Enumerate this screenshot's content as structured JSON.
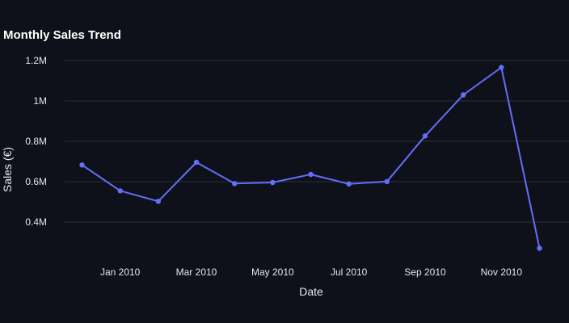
{
  "chart_data": {
    "type": "line",
    "title": "Monthly Sales Trend",
    "xlabel": "Date",
    "ylabel": "Sales (€)",
    "x": [
      "2009-12",
      "2010-01",
      "2010-02",
      "2010-03",
      "2010-04",
      "2010-05",
      "2010-06",
      "2010-07",
      "2010-08",
      "2010-09",
      "2010-10",
      "2010-11",
      "2010-12"
    ],
    "series": [
      {
        "values": [
          683000,
          555000,
          503000,
          696000,
          591000,
          596000,
          636000,
          589000,
          601000,
          827000,
          1030000,
          1166000,
          270000
        ]
      }
    ],
    "x_ticks": [
      {
        "value": "2010-01",
        "label": "Jan 2010"
      },
      {
        "value": "2010-03",
        "label": "Mar 2010"
      },
      {
        "value": "2010-05",
        "label": "May 2010"
      },
      {
        "value": "2010-07",
        "label": "Jul 2010"
      },
      {
        "value": "2010-09",
        "label": "Sep 2010"
      },
      {
        "value": "2010-11",
        "label": "Nov 2010"
      }
    ],
    "y_ticks": [
      {
        "value": 400000,
        "label": "0.4M"
      },
      {
        "value": 600000,
        "label": "0.6M"
      },
      {
        "value": 800000,
        "label": "0.8M"
      },
      {
        "value": 1000000,
        "label": "1M"
      },
      {
        "value": 1200000,
        "label": "1.2M"
      }
    ],
    "xlim": [
      "2009-12",
      "2010-12"
    ],
    "ylim": [
      220000,
      1260000
    ],
    "grid": "horizontal",
    "line_color": "#636efa",
    "background_color": "#0f111a",
    "grid_color": "#2a2f3b"
  }
}
